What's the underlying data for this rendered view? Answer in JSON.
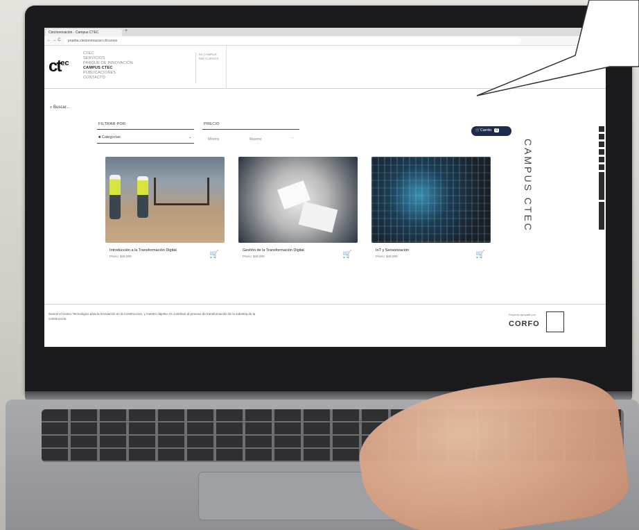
{
  "browser": {
    "tab_title": "CtecInnovación · Campus CTEC",
    "new_tab": "+",
    "nav": "← → C",
    "url": "prueba.ctecinnovacion.cl/cursos",
    "menu": "☆ ⋮"
  },
  "site": {
    "logo_main": "ct",
    "logo_sup": "ec",
    "nav_items": [
      "CTEC",
      "SERVICIOS",
      "PARQUE DE INNOVACIÓN",
      "CAMPUS CTEC",
      "PUBLICACIONES",
      "CONTACTO"
    ],
    "nav_active_index": 3,
    "nav_secondary": [
      "MI CAMPUS",
      "MIS CURSOS"
    ],
    "search_label": "⌕ Buscar..."
  },
  "filters": {
    "filter_by_label": "FILTRAR POR",
    "category_value": "Categorías",
    "price_label": "PRECIO",
    "min_placeholder": "Mínimo",
    "max_placeholder": "Máximo"
  },
  "cart": {
    "label": "Carrito",
    "count": "0"
  },
  "campus_vertical": "CAMPUS CTEC",
  "products": [
    {
      "title": "Introducción a la Transformación Digital",
      "price": "Precio: $40.000"
    },
    {
      "title": "Gestión de la Transformación Digital",
      "price": "Precio: $40.000"
    },
    {
      "title": "IoT y Sensorización",
      "price": "Precio: $40.000"
    }
  ],
  "footer": {
    "text": "Somos el Centro Tecnológico para la Innovación en la Construcción, y nuestro objetivo es contribuir al proceso de transformación de la industria de la construcción.",
    "kicker": "Proyecto apoyado por",
    "corfo": "CORFO"
  },
  "colors": {
    "accent": "#1e2b4a",
    "screen_bezel": "#1b1b1d"
  }
}
